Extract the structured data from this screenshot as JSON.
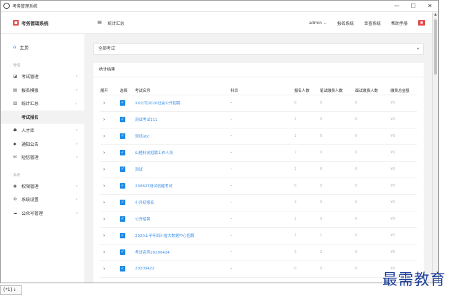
{
  "window": {
    "title": "考务管理系统",
    "controls": [
      "—",
      "☐",
      "✕"
    ]
  },
  "topbar": {
    "brand": "考务管理系统",
    "menu_icon": "≡",
    "breadcrumb": "统计汇总",
    "user": "admin",
    "user_caret": "⌄",
    "links": [
      "报名系统",
      "幸查系统",
      "帮助手册"
    ]
  },
  "sidebar": {
    "home": "主页",
    "group1": "管理",
    "items1": [
      {
        "icon": "◪",
        "label": "考试管理",
        "arrow": "‹"
      },
      {
        "icon": "▤",
        "label": "报名模板",
        "arrow": "‹"
      },
      {
        "icon": "▥",
        "label": "统计汇总",
        "arrow": "⌄"
      }
    ],
    "sub_item": "考试报名",
    "items2": [
      {
        "icon": "☗",
        "label": "人才库",
        "arrow": "‹"
      },
      {
        "icon": "◆",
        "label": "通知公告",
        "arrow": "‹"
      },
      {
        "icon": "✉",
        "label": "短信管理",
        "arrow": "‹"
      }
    ],
    "group2": "系统",
    "items3": [
      {
        "icon": "◉",
        "label": "权限管理",
        "arrow": "‹"
      },
      {
        "icon": "⚙",
        "label": "系统设置",
        "arrow": "‹"
      },
      {
        "icon": "☁",
        "label": "公众号管理",
        "arrow": "‹"
      }
    ]
  },
  "filter": {
    "selected": "全部考试",
    "caret": "▾"
  },
  "panel": {
    "tab": "统计结果"
  },
  "table": {
    "headers": [
      "展开",
      "选择",
      "考试名称",
      "科目",
      "报名人数",
      "笔试缴费人数",
      "面试缴费人数",
      "缴费总金额"
    ],
    "rows": [
      {
        "name": "XX公司2020社会公开招聘",
        "subject": "-",
        "sign": "0",
        "written": "0",
        "interview": "0",
        "total": "¥0"
      },
      {
        "name": "测试考试111",
        "subject": "-",
        "sign": "1",
        "written": "0",
        "interview": "0",
        "total": "¥0"
      },
      {
        "name": "测试abc",
        "subject": "-",
        "sign": "1",
        "written": "0",
        "interview": "0",
        "total": "¥0"
      },
      {
        "name": "山楂科技招聘工作人员",
        "subject": "-",
        "sign": "7",
        "written": "0",
        "interview": "0",
        "total": "¥0"
      },
      {
        "name": "测试",
        "subject": "-",
        "sign": "1",
        "written": "0",
        "interview": "0",
        "total": "¥0"
      },
      {
        "name": "200827测试创建考试",
        "subject": "-",
        "sign": "0",
        "written": "0",
        "interview": "0",
        "total": "¥0"
      },
      {
        "name": "小升初报名",
        "subject": "-",
        "sign": "2",
        "written": "0",
        "interview": "0",
        "total": "¥0"
      },
      {
        "name": "公开招聘",
        "subject": "-",
        "sign": "1",
        "written": "0",
        "interview": "0",
        "total": "¥0"
      },
      {
        "name": "2020上半年四川省大数据中心招聘",
        "subject": "-",
        "sign": "1",
        "written": "1",
        "interview": "0",
        "total": "¥0"
      },
      {
        "name": "考试名称20200424",
        "subject": "-",
        "sign": "3",
        "written": "2",
        "interview": "0",
        "total": "¥0"
      },
      {
        "name": "20200422",
        "subject": "-",
        "sign": "0",
        "written": "0",
        "interview": "0",
        "total": "¥0"
      }
    ]
  },
  "watermark": "最需教育",
  "taskbar": "{*1}↓"
}
